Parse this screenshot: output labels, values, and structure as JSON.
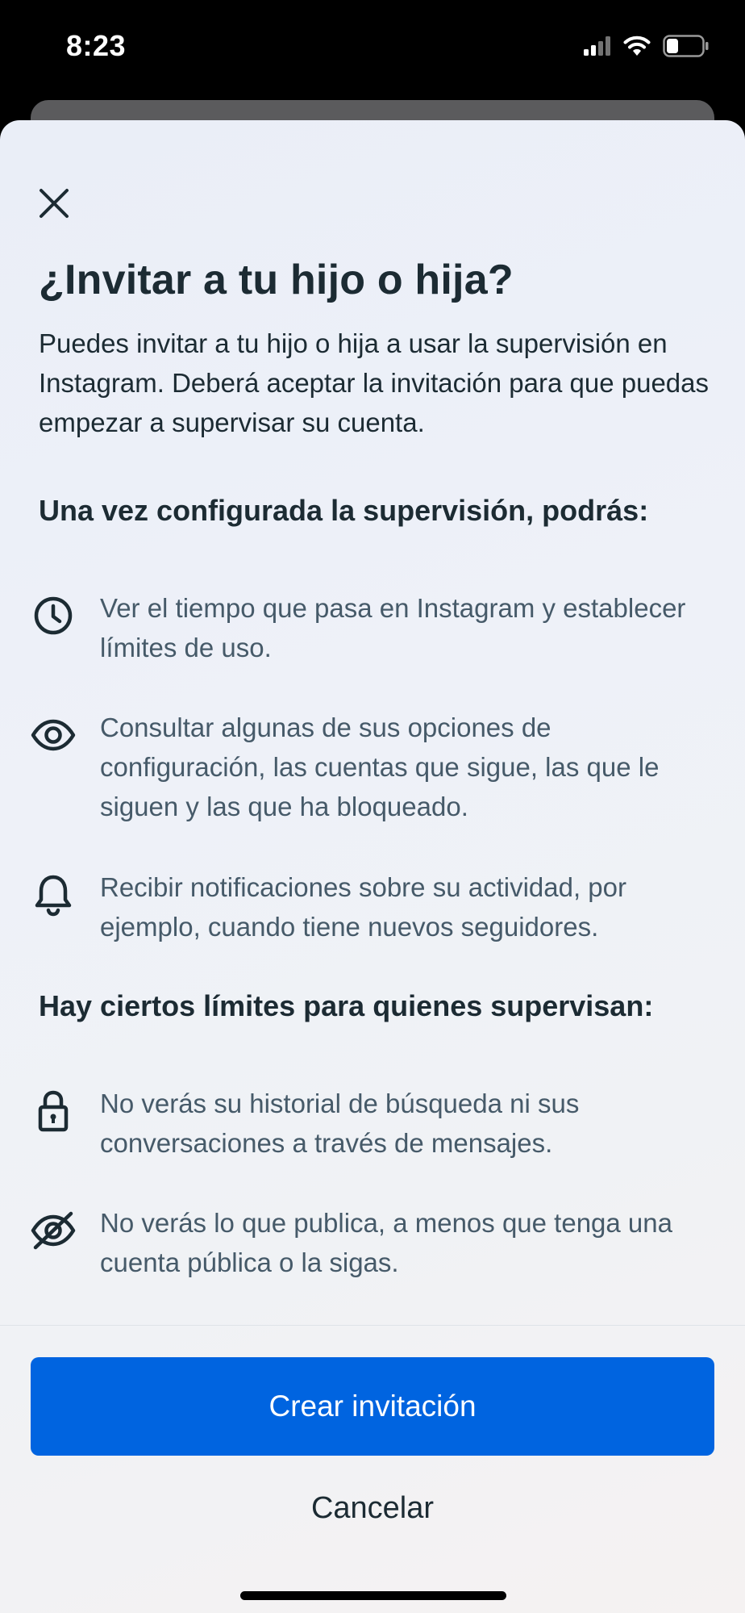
{
  "status_bar": {
    "time": "8:23",
    "icons": [
      "cellular-signal-icon",
      "wifi-icon",
      "battery-icon"
    ]
  },
  "sheet": {
    "title": "¿Invitar a tu hijo o hija?",
    "intro": "Puedes invitar a tu hijo o hija a usar la supervisión en Instagram. Deberá aceptar la invitación para que puedas empezar a supervisar su cuenta.",
    "section1": {
      "heading": "Una vez configurada la supervisión, podrás:",
      "items": [
        {
          "icon": "clock-icon",
          "text": "Ver el tiempo que pasa en Instagram y establecer límites de uso."
        },
        {
          "icon": "eye-icon",
          "text": "Consultar algunas de sus opciones de configuración, las cuentas que sigue, las que le siguen y las que ha bloqueado."
        },
        {
          "icon": "bell-icon",
          "text": "Recibir notificaciones sobre su actividad, por ejemplo, cuando tiene nuevos seguidores."
        }
      ]
    },
    "section2": {
      "heading": "Hay ciertos límites para quienes supervisan:",
      "items": [
        {
          "icon": "lock-icon",
          "text": "No verás su historial de búsqueda ni sus conversaciones a través de mensajes."
        },
        {
          "icon": "eye-off-icon",
          "text": "No verás lo que publica, a menos que tenga una cuenta pública o la sigas."
        }
      ]
    },
    "primary_button": "Crear invitación",
    "cancel_button": "Cancelar"
  },
  "colors": {
    "primary": "#0064e0",
    "text_dark": "#1c2b33",
    "text_secondary": "#465a69"
  }
}
